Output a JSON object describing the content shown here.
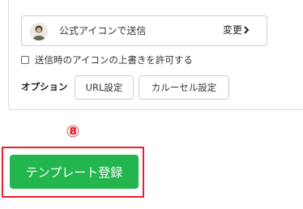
{
  "sender": {
    "label": "公式アイコンで送信",
    "change_label": "変更",
    "avatar_icon": "user-avatar"
  },
  "permission": {
    "label": "送信時のアイコンの上書きを許可する",
    "checked": false
  },
  "options": {
    "label": "オプション",
    "url_button": "URL設定",
    "carousel_button": "カルーセル設定"
  },
  "annotation": {
    "step": "⑧",
    "color": "#e4202a"
  },
  "register": {
    "label": "テンプレート登録",
    "color": "#23b64f"
  }
}
